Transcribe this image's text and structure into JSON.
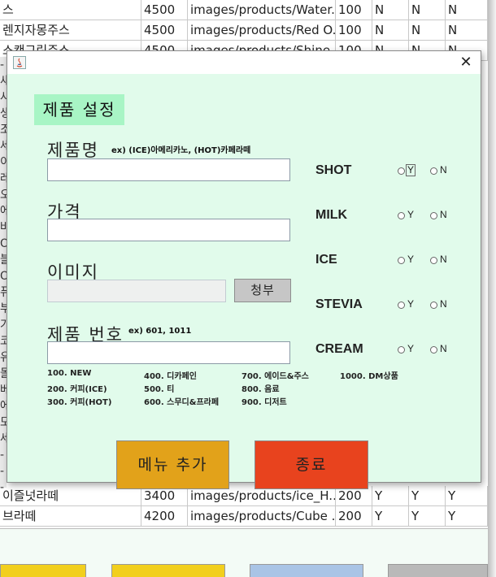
{
  "background_table": {
    "rows": [
      [
        "스",
        "4500",
        "images/products/Water...",
        "100",
        "N",
        "N",
        "N"
      ],
      [
        "렌지자몽주스",
        "4500",
        "images/products/Red O...",
        "100",
        "N",
        "N",
        "N"
      ],
      [
        "스캔그린주스",
        "4500",
        "images/products/Shine...",
        "100",
        "N",
        "N",
        "N"
      ]
    ],
    "bottom_rows": [
      [
        "이즐넛라떼",
        "3400",
        "images/products/ice_H...",
        "200",
        "Y",
        "Y",
        "Y"
      ],
      [
        "브라떼",
        "4200",
        "images/products/Cube ...",
        "200",
        "Y",
        "Y",
        "Y"
      ]
    ],
    "left_strip_chars": [
      "-",
      "새",
      "사",
      "생",
      "조",
      "세",
      "이",
      "레",
      "오",
      "에",
      "바",
      "O",
      "블",
      "O",
      "퓨",
      "부",
      "가",
      "코",
      "유",
      "돌",
      "베",
      "에",
      "모",
      "세",
      "-",
      "-",
      "-"
    ]
  },
  "dialog": {
    "close_glyph": "✕",
    "section_title": "제품 설정",
    "name": {
      "label": "제품명",
      "hint": "ex) (ICE)아메리카노, (HOT)카페라떼",
      "value": ""
    },
    "price": {
      "label": "가격",
      "value": ""
    },
    "image": {
      "label": "이미지",
      "value": "",
      "attach_label": "청부"
    },
    "number": {
      "label": "제품 번호",
      "hint": "ex) 601, 1011",
      "value": ""
    },
    "options": [
      {
        "label": "SHOT",
        "yes": "Y",
        "no": "N"
      },
      {
        "label": "MILK",
        "yes": "Y",
        "no": "N"
      },
      {
        "label": "ICE",
        "yes": "Y",
        "no": "N"
      },
      {
        "label": "STEVIA",
        "yes": "Y",
        "no": "N"
      },
      {
        "label": "CREAM",
        "yes": "Y",
        "no": "N"
      }
    ],
    "categories": [
      "100. NEW",
      "200. 커피(ICE)",
      "300. 커피(HOT)",
      "400. 디카페인",
      "500. 티",
      "600. 스무디&프라페",
      "700. 에이드&주스",
      "800. 음료",
      "900. 디저트",
      "1000. DM상품"
    ],
    "add_button": "메뉴 추가",
    "exit_button": "종료"
  },
  "colors": {
    "content_bg": "#e1fbeb",
    "title_badge": "#a8f5c5",
    "add_button": "#e2a21a",
    "exit_button": "#e8431e"
  }
}
